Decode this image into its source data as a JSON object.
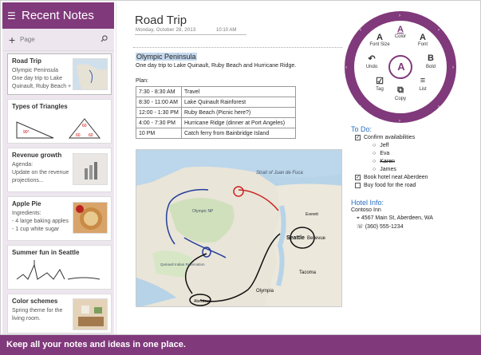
{
  "sidebar": {
    "title": "Recent Notes",
    "search_placeholder": "Page",
    "notes": [
      {
        "title": "Road Trip",
        "lines": [
          "Olympic Peninsula",
          "One day trip to Lake",
          "Quinault, Ruby Beach + ..."
        ]
      },
      {
        "title": "Types of Triangles",
        "lines": []
      },
      {
        "title": "Revenue growth",
        "lines": [
          "Agenda:",
          "Update on the revenue",
          "projections..."
        ]
      },
      {
        "title": "Apple Pie",
        "lines": [
          "Ingredients:",
          "- 4 large baking apples",
          "- 1 cup white sugar"
        ]
      },
      {
        "title": "Summer fun in Seattle",
        "lines": []
      },
      {
        "title": "Color schemes",
        "lines": [
          "Spring theme for the",
          "living room."
        ]
      }
    ]
  },
  "page": {
    "title": "Road Trip",
    "date": "Monday, October 28, 2013",
    "time": "10:10 AM",
    "heading": "Olympic Peninsula",
    "subtitle": "One day trip to Lake Quinault, Ruby Beach and Hurricane Ridge.",
    "plan_label": "Plan:",
    "schedule": [
      {
        "time": "7:30 - 8:30 AM",
        "activity": "Travel"
      },
      {
        "time": "8:30 - 11:00 AM",
        "activity": "Lake Quinault Rainforest"
      },
      {
        "time": "12:00 - 1:30 PM",
        "activity": "Ruby Beach (Picnic here?)"
      },
      {
        "time": "4:00 - 7:30 PM",
        "activity": "Hurricane Ridge (dinner at Port Angeles)"
      },
      {
        "time": "10 PM",
        "activity": "Catch ferry from Bainbridge Island"
      }
    ]
  },
  "map": {
    "labels": [
      "Strait of Juan de Fuca",
      "Olympic NP",
      "Seattle",
      "Bellevue",
      "Tacoma",
      "Olympia",
      "Aberdeen",
      "Everett",
      "Quinault Indian Reservation"
    ]
  },
  "radial": {
    "center": "A",
    "items": [
      {
        "glyph": "A",
        "label": "Color"
      },
      {
        "glyph": "A",
        "label": "Font"
      },
      {
        "glyph": "B",
        "label": "Bold"
      },
      {
        "glyph": "≡",
        "label": "List"
      },
      {
        "glyph": "⧉",
        "label": "Copy"
      },
      {
        "glyph": "☑",
        "label": "Tag"
      },
      {
        "glyph": "↶",
        "label": "Undo"
      },
      {
        "glyph": "A",
        "label": "Font Size"
      }
    ]
  },
  "todo": {
    "heading": "To Do:",
    "items": [
      {
        "text": "Confirm availabilities",
        "checked": true
      },
      {
        "text": "Book hotel neat Aberdeen",
        "checked": true
      },
      {
        "text": "Buy food for the road",
        "checked": false
      }
    ],
    "people": [
      "Jeff",
      "Eva",
      "Karen",
      "James"
    ]
  },
  "hotel": {
    "heading": "Hotel Info:",
    "name": "Contoso Inn",
    "address": "4567 Main St, Aberdeen, WA",
    "phone": "(360) 555-1234"
  },
  "footer": {
    "text": "Keep all your notes and ideas in one place."
  },
  "colors": {
    "accent": "#80397b",
    "highlight": "#c5d9ee",
    "heading_blue": "#2a6fbf"
  }
}
